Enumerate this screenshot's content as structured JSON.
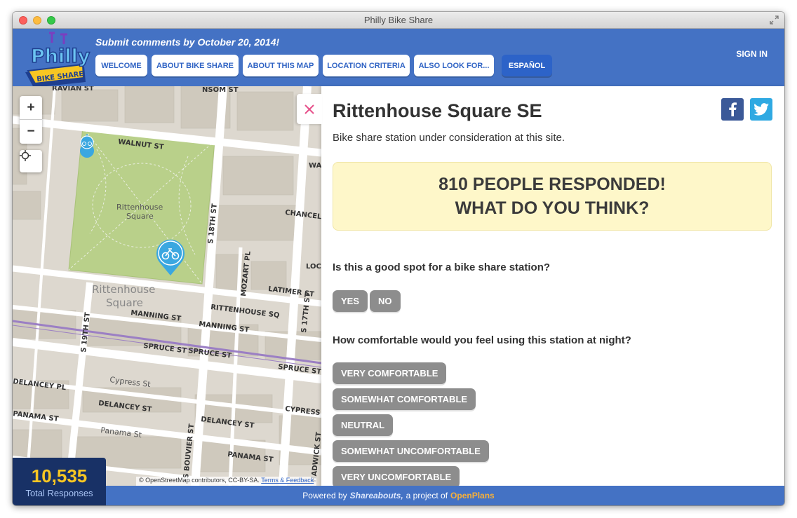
{
  "window": {
    "title": "Philly Bike Share"
  },
  "header": {
    "logo_text_top": "Philly",
    "logo_text_bottom": "BIKE SHARE",
    "deadline": "Submit comments by October 20, 2014!",
    "nav": [
      "WELCOME",
      "ABOUT BIKE SHARE",
      "ABOUT THIS MAP",
      "LOCATION CRITERIA",
      "ALSO LOOK FOR..."
    ],
    "language": "ESPAÑOL",
    "sign_in": "SIGN IN"
  },
  "map": {
    "zoom_in": "+",
    "zoom_out": "−",
    "streets": {
      "walnut": "WALNUT ST",
      "s18th": "S 18TH ST",
      "s17th": "S 17TH ST",
      "s19th": "S 19TH ST",
      "rittenhouse_sq": "RITTENHOUSE SQ",
      "manning": "MANNING ST",
      "spruce": "SPRUCE ST",
      "spruce_short": "SPRUCE ST",
      "spruce_right": "SPRUCE ST",
      "delancey_pl": "DELANCEY PL",
      "delancey": "DELANCEY ST",
      "panama": "PANAMA ST",
      "panama_small": "Panama St",
      "cypress_small": "Cypress St",
      "cypress": "CYPRESS",
      "latimer": "LATIMER ST",
      "mozart": "MOZART PL",
      "chancellor": "CHANCEL",
      "locust": "LOC",
      "wa": "WA",
      "manning_right": "MANNING ST",
      "bouvier": "S BOUVIER ST",
      "hadwick": "HADWICK ST",
      "sansom": "NSOM ST",
      "chestnut": "RAVIAN ST",
      "park_name": "Rittenhouse Square",
      "area_name": "Rittenhouse Square"
    },
    "attribution": "© OpenStreetMap contributors, CC-BY-SA.",
    "attribution_link": "Terms & Feedback"
  },
  "stats": {
    "total": "10,535",
    "label": "Total Responses"
  },
  "place": {
    "title": "Rittenhouse Square SE",
    "description": "Bike share station under consideration at this site.",
    "responded_line1": "810 PEOPLE RESPONDED!",
    "responded_line2": "WHAT DO YOU THINK?"
  },
  "survey": {
    "q1": "Is this a good spot for a bike share station?",
    "q1_options": [
      "YES",
      "NO"
    ],
    "q2": "How comfortable would you feel using this station at night?",
    "q2_options": [
      "VERY COMFORTABLE",
      "SOMEWHAT COMFORTABLE",
      "NEUTRAL",
      "SOMEWHAT UNCOMFORTABLE",
      "VERY UNCOMFORTABLE"
    ]
  },
  "footer": {
    "powered": "Powered by",
    "brand": "Shareabouts,",
    "project": "a project of",
    "org": "OpenPlans"
  },
  "colors": {
    "header_blue": "#4472c4",
    "accent_yellow": "#f7c623",
    "option_gray": "#8d8d8d"
  }
}
